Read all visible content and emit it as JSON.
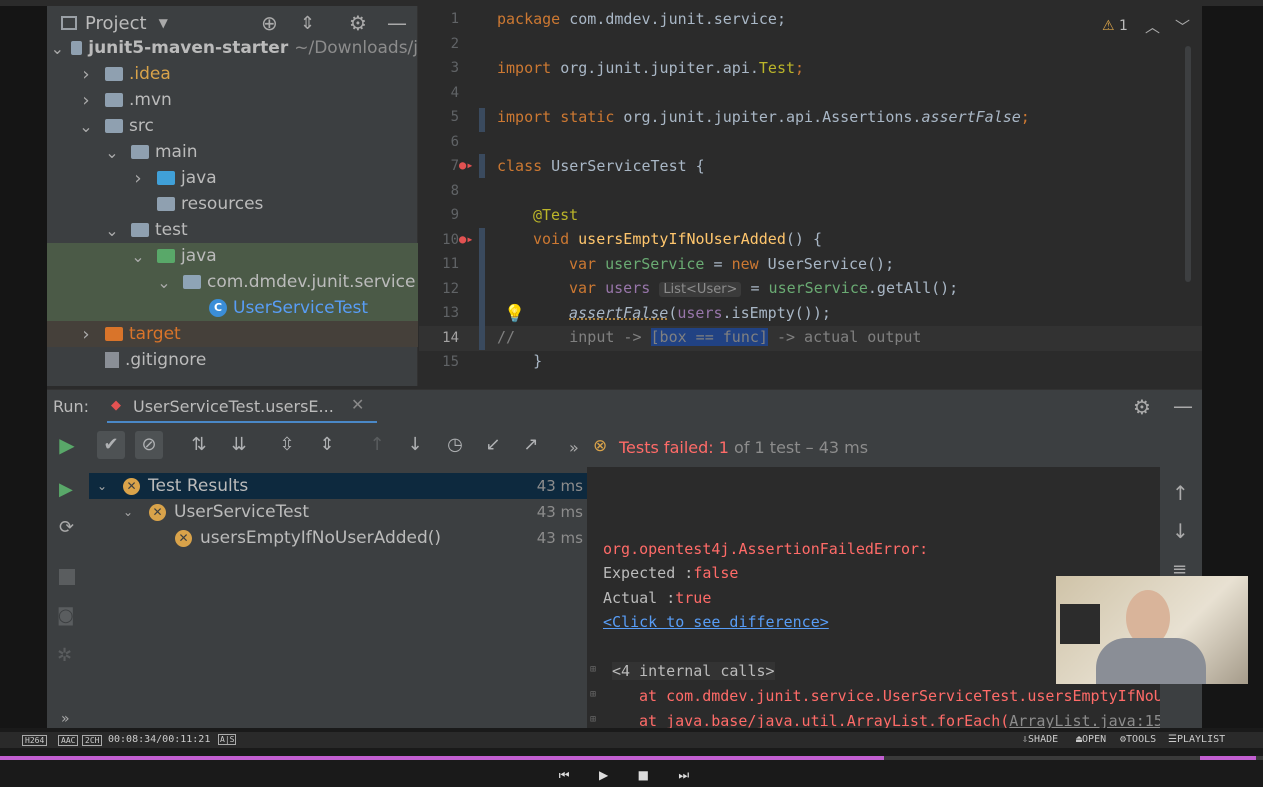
{
  "project_panel": {
    "title": "Project",
    "tree": [
      {
        "label": "junit5-maven-starter",
        "suffix": "~/Downloads/j",
        "depth": 0,
        "arrow": "down",
        "icon": "folder"
      },
      {
        "label": ".idea",
        "depth": 1,
        "arrow": "right",
        "icon": "folder"
      },
      {
        "label": ".mvn",
        "depth": 1,
        "arrow": "right",
        "icon": "folder"
      },
      {
        "label": "src",
        "depth": 1,
        "arrow": "down",
        "icon": "folder"
      },
      {
        "label": "main",
        "depth": 2,
        "arrow": "down",
        "icon": "folder"
      },
      {
        "label": "java",
        "depth": 3,
        "arrow": "right",
        "icon": "folder-source"
      },
      {
        "label": "resources",
        "depth": 3,
        "arrow": "",
        "icon": "folder-resources"
      },
      {
        "label": "test",
        "depth": 2,
        "arrow": "down",
        "icon": "folder"
      },
      {
        "label": "java",
        "depth": 3,
        "arrow": "down",
        "icon": "folder-test"
      },
      {
        "label": "com.dmdev.junit.service",
        "depth": 4,
        "arrow": "down",
        "icon": "package"
      },
      {
        "label": "UserServiceTest",
        "depth": 5,
        "arrow": "",
        "icon": "class"
      },
      {
        "label": "target",
        "depth": 1,
        "arrow": "right",
        "icon": "folder-excluded"
      },
      {
        "label": ".gitignore",
        "depth": 1,
        "arrow": "",
        "icon": "file"
      }
    ]
  },
  "editor": {
    "warnings_count": "1",
    "line_numbers": [
      "1",
      "2",
      "3",
      "4",
      "5",
      "6",
      "7",
      "8",
      "9",
      "10",
      "11",
      "12",
      "13",
      "14",
      "15"
    ],
    "lines": {
      "l1_kw": "package",
      "l1_rest": " com.dmdev.junit.service;",
      "l3_kw": "import",
      "l3_rest": " org.junit.jupiter.api.",
      "l3_cls": "Test",
      ";": ";",
      "l5_kw": "import static",
      "l5_rest": " org.junit.jupiter.api.Assertions.",
      "l5_fn": "assertFalse",
      "l7_kw": "class",
      "l7_rest": " UserServiceTest {",
      "l9_ann": "@Test",
      "l10_kw": "void",
      "l10_fn": "usersEmptyIfNoUserAdded",
      "l10_rest": "() {",
      "l11_kw": "var",
      "l11_var": "userService",
      "l11_eq": " = ",
      "l11_kw2": "new",
      "l11_rest": " UserService();",
      "l12_kw": "var",
      "l12_var": "users",
      "l12_hint": "List<User>",
      "l12_eq": " = ",
      "l12_var2": "userService",
      "l12_rest": ".getAll();",
      "l13_fn": "assertFalse",
      "l13_open": "(",
      "l13_var": "users",
      "l13_rest": ".isEmpty());",
      "l14_com1": "//      input -> ",
      "l14_sel": "[box == func]",
      "l14_com2": " -> actual output",
      "l15": "    }",
      "semi": ";"
    }
  },
  "run": {
    "label": "Run:",
    "tab": "UserServiceTest.usersE...",
    "status_prefix": "Tests failed:",
    "status_count": "1",
    "status_rest": "of 1 test – 43 ms",
    "more": "»",
    "results": [
      {
        "label": "Test Results",
        "time": "43 ms",
        "depth": 0
      },
      {
        "label": "UserServiceTest",
        "time": "43 ms",
        "depth": 1
      },
      {
        "label": "usersEmptyIfNoUserAdded()",
        "time": "43 ms",
        "depth": 2
      }
    ],
    "console": {
      "error": "org.opentest4j.AssertionFailedError:",
      "expected_label": "Expected :",
      "expected_val": "false",
      "actual_label": "Actual   :",
      "actual_val": "true",
      "diff_link": "<Click to see difference>",
      "internal": "<4 internal calls>",
      "at1": "at com.dmdev.junit.service.UserServiceTest.usersEmptyIfNoU",
      "at2_pre": "at java.base/java.util.ArrayList.forEach(",
      "at2_link": "ArrayList.java:15"
    }
  },
  "player": {
    "badges": [
      "H264",
      "AAC",
      "2CH"
    ],
    "time": "00:08:34/00:11:21",
    "ab": "A|S",
    "shade": "SHADE",
    "open": "OPEN",
    "tools": "TOOLS",
    "playlist": "PLAYLIST",
    "progress": 0.7
  }
}
